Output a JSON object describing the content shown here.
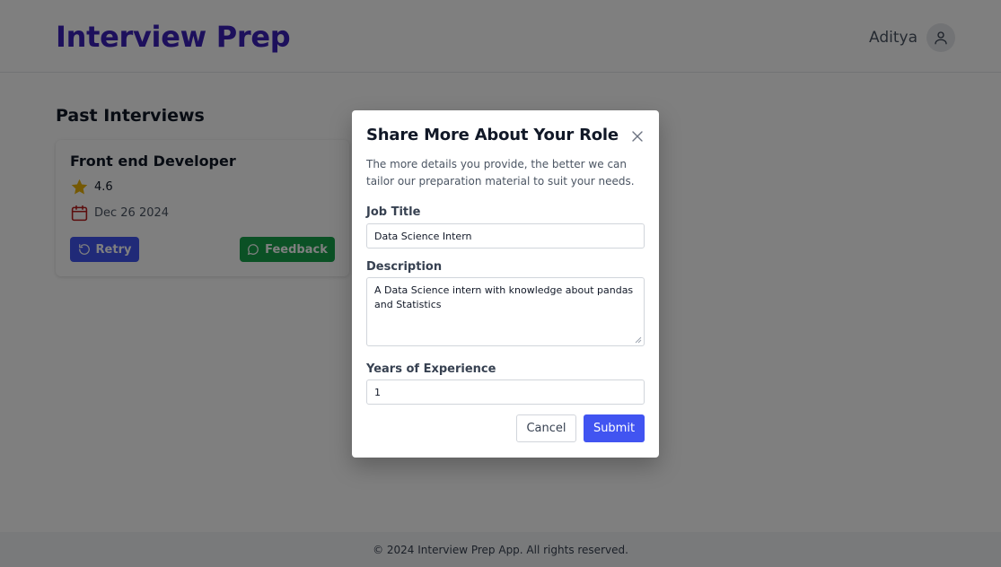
{
  "header": {
    "brand": "Interview Prep",
    "username": "Aditya",
    "avatar_icon": "user-icon"
  },
  "main": {
    "section_title": "Past Interviews",
    "interviews": [
      {
        "title": "Front end Developer",
        "rating": "4.6",
        "date": "Dec 26 2024",
        "retry_label": "Retry",
        "feedback_label": "Feedback"
      }
    ]
  },
  "footer": {
    "text": "© 2024 Interview Prep App. All rights reserved."
  },
  "modal": {
    "title": "Share More About Your Role",
    "description": "The more details you provide, the better we can tailor our preparation material to suit your needs.",
    "job_title_label": "Job Title",
    "job_title_value": "Data Science Intern",
    "description_label": "Description",
    "description_value": "A Data Science intern with knowledge about pandas and Statistics",
    "experience_label": "Years of Experience",
    "experience_value": "1",
    "cancel_label": "Cancel",
    "submit_label": "Submit"
  },
  "colors": {
    "brand": "#3b20b8",
    "primary": "#4154f1",
    "success": "#16a34a",
    "star": "#eab308",
    "calendar": "#b91c1c"
  }
}
